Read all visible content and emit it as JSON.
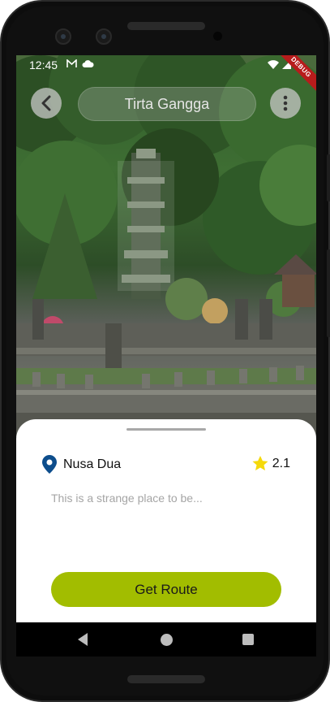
{
  "status_bar": {
    "time": "12:45",
    "debug_label": "DEBUG"
  },
  "header": {
    "title": "Tirta Gangga",
    "back_icon": "chevron-left-icon",
    "menu_icon": "more-vertical-icon"
  },
  "sheet": {
    "location_name": "Nusa Dua",
    "location_icon": "map-pin-icon",
    "rating": "2.1",
    "rating_icon": "star-icon",
    "description": "This is a strange place to be...",
    "route_button_label": "Get Route"
  },
  "colors": {
    "accent": "#a2bd00",
    "pin": "#0d4d8c",
    "star": "#f5d90a"
  }
}
